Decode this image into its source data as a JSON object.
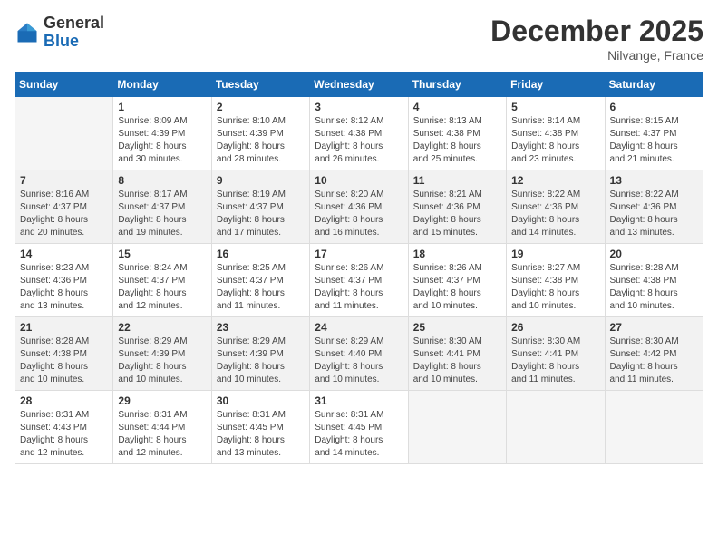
{
  "header": {
    "logo_line1": "General",
    "logo_line2": "Blue",
    "month_title": "December 2025",
    "location": "Nilvange, France"
  },
  "calendar": {
    "weekdays": [
      "Sunday",
      "Monday",
      "Tuesday",
      "Wednesday",
      "Thursday",
      "Friday",
      "Saturday"
    ],
    "weeks": [
      [
        {
          "day": "",
          "info": ""
        },
        {
          "day": "1",
          "info": "Sunrise: 8:09 AM\nSunset: 4:39 PM\nDaylight: 8 hours\nand 30 minutes."
        },
        {
          "day": "2",
          "info": "Sunrise: 8:10 AM\nSunset: 4:39 PM\nDaylight: 8 hours\nand 28 minutes."
        },
        {
          "day": "3",
          "info": "Sunrise: 8:12 AM\nSunset: 4:38 PM\nDaylight: 8 hours\nand 26 minutes."
        },
        {
          "day": "4",
          "info": "Sunrise: 8:13 AM\nSunset: 4:38 PM\nDaylight: 8 hours\nand 25 minutes."
        },
        {
          "day": "5",
          "info": "Sunrise: 8:14 AM\nSunset: 4:38 PM\nDaylight: 8 hours\nand 23 minutes."
        },
        {
          "day": "6",
          "info": "Sunrise: 8:15 AM\nSunset: 4:37 PM\nDaylight: 8 hours\nand 21 minutes."
        }
      ],
      [
        {
          "day": "7",
          "info": "Sunrise: 8:16 AM\nSunset: 4:37 PM\nDaylight: 8 hours\nand 20 minutes."
        },
        {
          "day": "8",
          "info": "Sunrise: 8:17 AM\nSunset: 4:37 PM\nDaylight: 8 hours\nand 19 minutes."
        },
        {
          "day": "9",
          "info": "Sunrise: 8:19 AM\nSunset: 4:37 PM\nDaylight: 8 hours\nand 17 minutes."
        },
        {
          "day": "10",
          "info": "Sunrise: 8:20 AM\nSunset: 4:36 PM\nDaylight: 8 hours\nand 16 minutes."
        },
        {
          "day": "11",
          "info": "Sunrise: 8:21 AM\nSunset: 4:36 PM\nDaylight: 8 hours\nand 15 minutes."
        },
        {
          "day": "12",
          "info": "Sunrise: 8:22 AM\nSunset: 4:36 PM\nDaylight: 8 hours\nand 14 minutes."
        },
        {
          "day": "13",
          "info": "Sunrise: 8:22 AM\nSunset: 4:36 PM\nDaylight: 8 hours\nand 13 minutes."
        }
      ],
      [
        {
          "day": "14",
          "info": "Sunrise: 8:23 AM\nSunset: 4:36 PM\nDaylight: 8 hours\nand 13 minutes."
        },
        {
          "day": "15",
          "info": "Sunrise: 8:24 AM\nSunset: 4:37 PM\nDaylight: 8 hours\nand 12 minutes."
        },
        {
          "day": "16",
          "info": "Sunrise: 8:25 AM\nSunset: 4:37 PM\nDaylight: 8 hours\nand 11 minutes."
        },
        {
          "day": "17",
          "info": "Sunrise: 8:26 AM\nSunset: 4:37 PM\nDaylight: 8 hours\nand 11 minutes."
        },
        {
          "day": "18",
          "info": "Sunrise: 8:26 AM\nSunset: 4:37 PM\nDaylight: 8 hours\nand 10 minutes."
        },
        {
          "day": "19",
          "info": "Sunrise: 8:27 AM\nSunset: 4:38 PM\nDaylight: 8 hours\nand 10 minutes."
        },
        {
          "day": "20",
          "info": "Sunrise: 8:28 AM\nSunset: 4:38 PM\nDaylight: 8 hours\nand 10 minutes."
        }
      ],
      [
        {
          "day": "21",
          "info": "Sunrise: 8:28 AM\nSunset: 4:38 PM\nDaylight: 8 hours\nand 10 minutes."
        },
        {
          "day": "22",
          "info": "Sunrise: 8:29 AM\nSunset: 4:39 PM\nDaylight: 8 hours\nand 10 minutes."
        },
        {
          "day": "23",
          "info": "Sunrise: 8:29 AM\nSunset: 4:39 PM\nDaylight: 8 hours\nand 10 minutes."
        },
        {
          "day": "24",
          "info": "Sunrise: 8:29 AM\nSunset: 4:40 PM\nDaylight: 8 hours\nand 10 minutes."
        },
        {
          "day": "25",
          "info": "Sunrise: 8:30 AM\nSunset: 4:41 PM\nDaylight: 8 hours\nand 10 minutes."
        },
        {
          "day": "26",
          "info": "Sunrise: 8:30 AM\nSunset: 4:41 PM\nDaylight: 8 hours\nand 11 minutes."
        },
        {
          "day": "27",
          "info": "Sunrise: 8:30 AM\nSunset: 4:42 PM\nDaylight: 8 hours\nand 11 minutes."
        }
      ],
      [
        {
          "day": "28",
          "info": "Sunrise: 8:31 AM\nSunset: 4:43 PM\nDaylight: 8 hours\nand 12 minutes."
        },
        {
          "day": "29",
          "info": "Sunrise: 8:31 AM\nSunset: 4:44 PM\nDaylight: 8 hours\nand 12 minutes."
        },
        {
          "day": "30",
          "info": "Sunrise: 8:31 AM\nSunset: 4:45 PM\nDaylight: 8 hours\nand 13 minutes."
        },
        {
          "day": "31",
          "info": "Sunrise: 8:31 AM\nSunset: 4:45 PM\nDaylight: 8 hours\nand 14 minutes."
        },
        {
          "day": "",
          "info": ""
        },
        {
          "day": "",
          "info": ""
        },
        {
          "day": "",
          "info": ""
        }
      ]
    ]
  }
}
